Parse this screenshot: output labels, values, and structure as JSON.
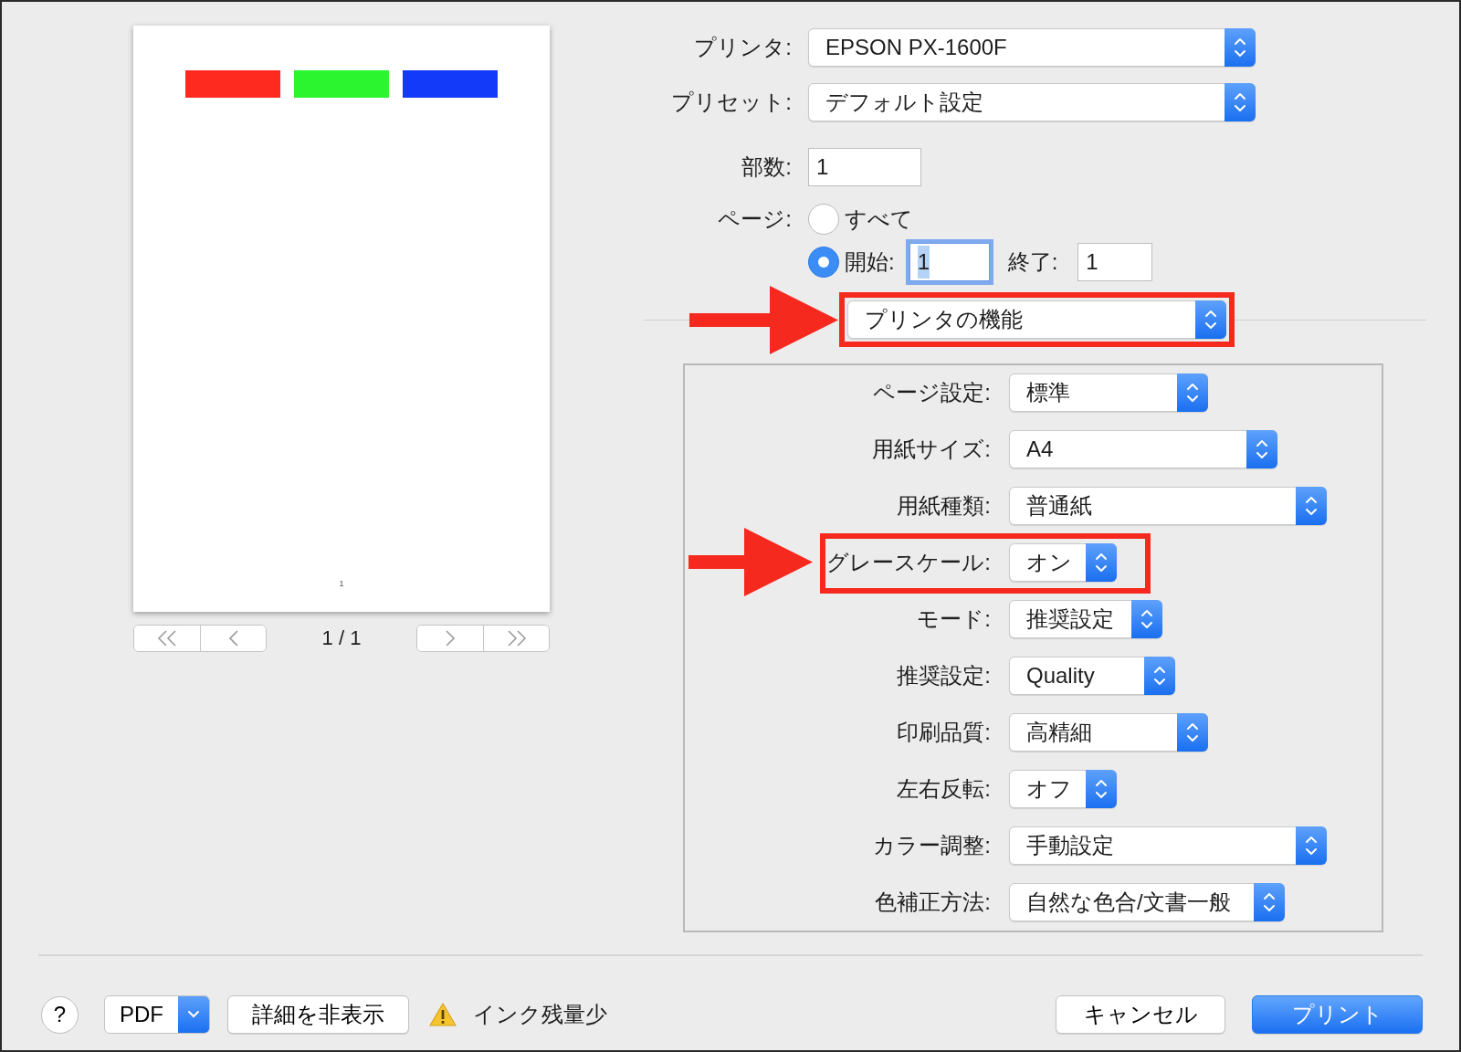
{
  "preview": {
    "swatches": [
      {
        "color": "#ff2a1f"
      },
      {
        "color": "#2af52e"
      },
      {
        "color": "#123af8"
      }
    ],
    "page_number": "1",
    "page_indicator": "1 / 1"
  },
  "printer": {
    "label": "プリンタ:",
    "value": "EPSON PX-1600F"
  },
  "preset": {
    "label": "プリセット:",
    "value": "デフォルト設定"
  },
  "copies": {
    "label": "部数:",
    "value": "1"
  },
  "pages": {
    "label": "ページ:",
    "options": [
      {
        "label": "すべて",
        "selected": false
      },
      {
        "label": "開始:",
        "selected": true
      }
    ],
    "from": {
      "value": "1",
      "focused": true
    },
    "to_label": "終了:",
    "to": {
      "value": "1",
      "focused": false
    }
  },
  "section_popup": {
    "value": "プリンタの機能",
    "highlighted": true
  },
  "settings": [
    {
      "label": "ページ設定:",
      "value": "標準",
      "highlighted": false
    },
    {
      "label": "用紙サイズ:",
      "value": "A4",
      "highlighted": false
    },
    {
      "label": "用紙種類:",
      "value": "普通紙",
      "highlighted": false
    },
    {
      "label": "グレースケール:",
      "value": "オン",
      "highlighted": true
    },
    {
      "label": "モード:",
      "value": "推奨設定",
      "highlighted": false
    },
    {
      "label": "推奨設定:",
      "value": "Quality",
      "highlighted": false
    },
    {
      "label": "印刷品質:",
      "value": "高精細",
      "highlighted": false
    },
    {
      "label": "左右反転:",
      "value": "オフ",
      "highlighted": false
    },
    {
      "label": "カラー調整:",
      "value": "手動設定",
      "highlighted": false
    },
    {
      "label": "色補正方法:",
      "value": "自然な色合/文書一般",
      "highlighted": false
    }
  ],
  "footer": {
    "help": "?",
    "pdf": "PDF",
    "details": "詳細を非表示",
    "warning": "インク残量少",
    "buttons": [
      {
        "label": "キャンセル",
        "kind": "plain"
      },
      {
        "label": "プリント",
        "kind": "default"
      }
    ]
  }
}
